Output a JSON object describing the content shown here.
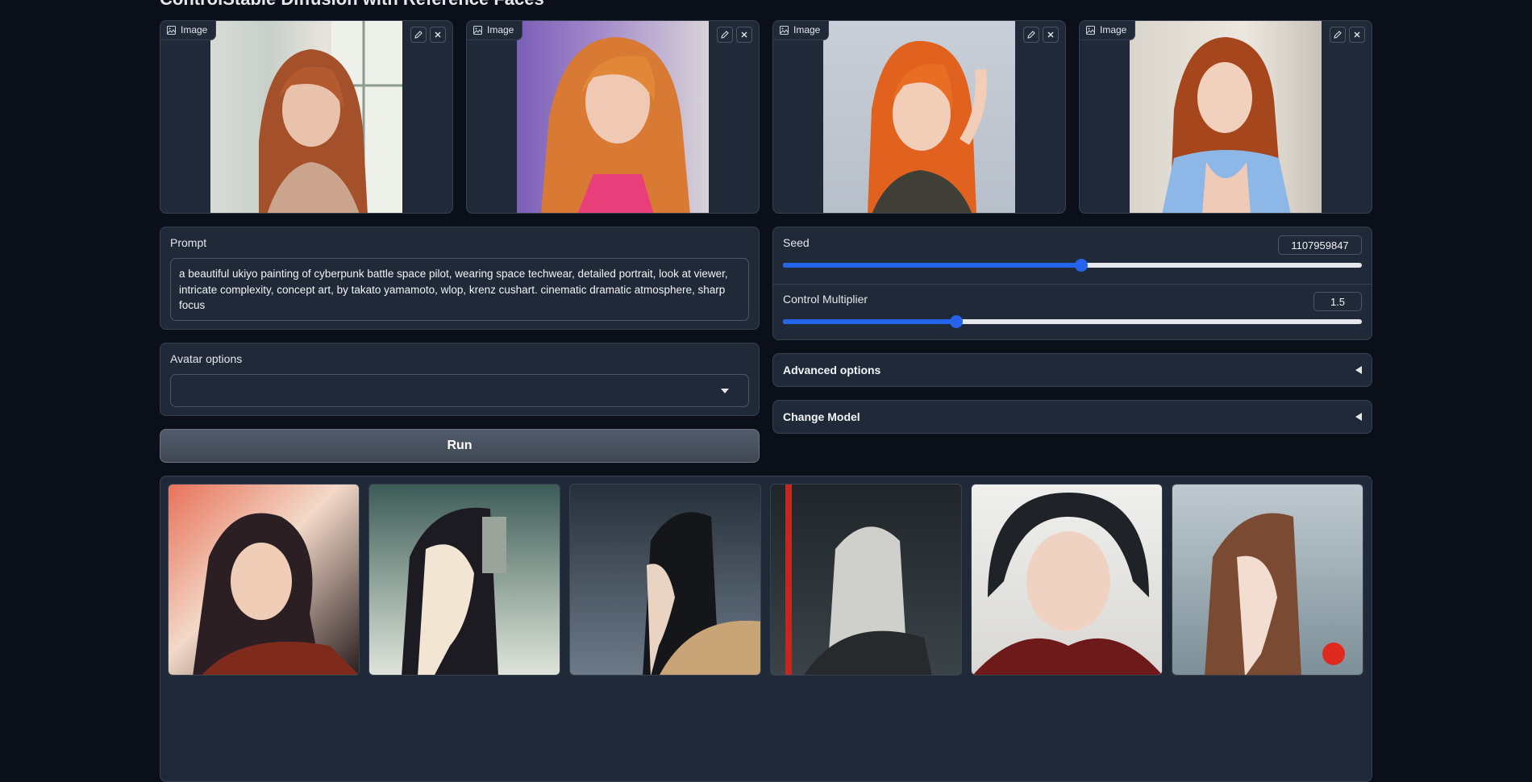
{
  "page": {
    "title": "ControlStable Diffusion with Reference Faces"
  },
  "reference_images": [
    {
      "label": "Image",
      "edit_icon": "pencil-icon",
      "clear_icon": "close-icon"
    },
    {
      "label": "Image",
      "edit_icon": "pencil-icon",
      "clear_icon": "close-icon"
    },
    {
      "label": "Image",
      "edit_icon": "pencil-icon",
      "clear_icon": "close-icon"
    },
    {
      "label": "Image",
      "edit_icon": "pencil-icon",
      "clear_icon": "close-icon"
    }
  ],
  "prompt": {
    "label": "Prompt",
    "value": "a beautiful ukiyo painting of cyberpunk battle space pilot, wearing space techwear, detailed portrait, look at viewer, intricate complexity, concept art, by takato yamamoto, wlop, krenz cushart. cinematic dramatic atmosphere, sharp focus"
  },
  "avatar_options": {
    "label": "Avatar options",
    "selected": ""
  },
  "run_button": {
    "label": "Run"
  },
  "seed": {
    "label": "Seed",
    "value": "1107959847",
    "slider_fraction": 0.516
  },
  "control_multiplier": {
    "label": "Control Multiplier",
    "value": "1.5",
    "slider_fraction": 0.3
  },
  "advanced_options": {
    "label": "Advanced options"
  },
  "change_model": {
    "label": "Change Model"
  },
  "colors": {
    "background": "#0b0f19",
    "panel": "#1f2937",
    "border": "#374151",
    "accent": "#2563eb"
  },
  "gallery": {
    "count": 6
  }
}
